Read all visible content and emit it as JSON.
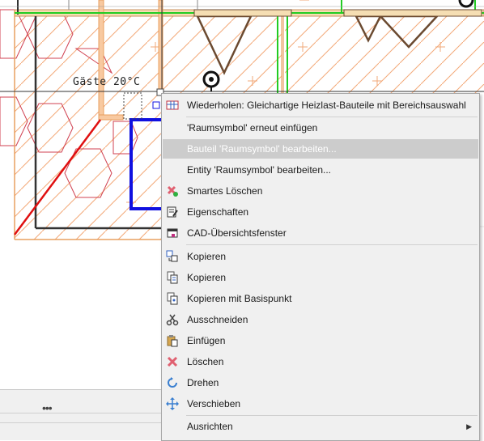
{
  "canvas": {
    "room_label": "Gäste 20°C"
  },
  "statusbar": {
    "dots": "•••"
  },
  "context_menu": {
    "items": [
      {
        "label": "Wiederholen: Gleichartige Heizlast-Bauteile mit Bereichsauswahl",
        "icon": "repeat-table-icon"
      },
      {
        "label": "'Raumsymbol' erneut einfügen",
        "icon": ""
      },
      {
        "label": "Bauteil 'Raumsymbol' bearbeiten...",
        "icon": "",
        "state": "highlighted"
      },
      {
        "label": "Entity 'Raumsymbol' bearbeiten...",
        "icon": ""
      },
      {
        "label": "Smartes Löschen",
        "icon": "smart-delete-icon"
      },
      {
        "label": "Eigenschaften",
        "icon": "properties-icon"
      },
      {
        "label": "CAD-Übersichtsfenster",
        "icon": "overview-window-icon"
      },
      {
        "label": "Kopieren",
        "icon": "copy-objects-icon"
      },
      {
        "label": "Kopieren",
        "icon": "copy-icon"
      },
      {
        "label": "Kopieren mit Basispunkt",
        "icon": "copy-basepoint-icon"
      },
      {
        "label": "Ausschneiden",
        "icon": "scissors-icon"
      },
      {
        "label": "Einfügen",
        "icon": "paste-icon"
      },
      {
        "label": "Löschen",
        "icon": "delete-x-icon"
      },
      {
        "label": "Drehen",
        "icon": "rotate-icon"
      },
      {
        "label": "Verschieben",
        "icon": "move-arrows-icon"
      },
      {
        "label": "Ausrichten",
        "icon": "",
        "submenu": true
      }
    ],
    "colors": {
      "highlight": "#cccccc",
      "delete": "#e06070",
      "rotate": "#3a7fd0"
    }
  }
}
